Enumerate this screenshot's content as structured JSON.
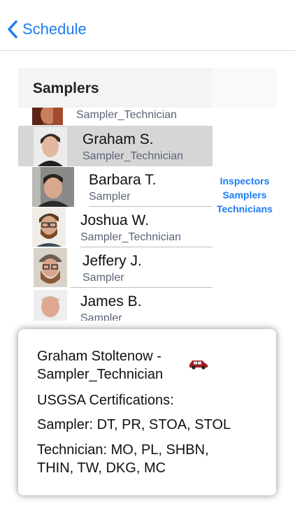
{
  "nav": {
    "back_label": "Schedule"
  },
  "list": {
    "title": "Samplers",
    "rows": [
      {
        "name": "",
        "role": "Sampler_Technician"
      },
      {
        "name": "Graham S.",
        "role": "Sampler_Technician"
      },
      {
        "name": "Barbara T.",
        "role": "Sampler"
      },
      {
        "name": "Joshua W.",
        "role": "Sampler_Technician"
      },
      {
        "name": "Jeffery J.",
        "role": "Sampler"
      },
      {
        "name": "James B.",
        "role": "Sampler"
      }
    ]
  },
  "index": [
    "Inspectors",
    "Samplers",
    "Technicians"
  ],
  "popup": {
    "line1": "Graham Stoltenow -",
    "line2": "Sampler_Technician",
    "line3": "USGSA Certifications:",
    "line4": "Sampler: DT, PR, STOA, STOL",
    "line5": "Technician: MO, PL, SHBN,",
    "line6": "THIN, TW, DKG, MC",
    "vehicle_icon": "car-icon"
  },
  "colors": {
    "accent": "#1d7cf2",
    "selected_row": "#d6d6d6",
    "car": "#a02020"
  }
}
